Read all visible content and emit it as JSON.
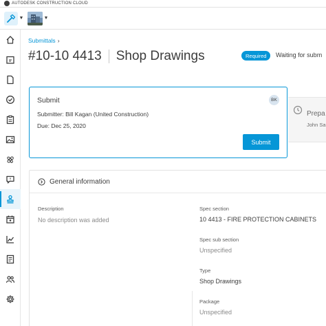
{
  "app": {
    "brand": "AUTODESK CONSTRUCTION CLOUD"
  },
  "toolbar": {
    "tool_icon": "hammer-icon",
    "project_icon": "building-thumbnail"
  },
  "sidebar": {
    "items": [
      {
        "name": "home",
        "icon": "home-icon"
      },
      {
        "name": "sheets",
        "icon": "sheets-icon"
      },
      {
        "name": "files",
        "icon": "file-icon"
      },
      {
        "name": "issues",
        "icon": "check-circle-icon"
      },
      {
        "name": "forms",
        "icon": "clipboard-icon"
      },
      {
        "name": "photos",
        "icon": "photo-icon"
      },
      {
        "name": "models",
        "icon": "model-icon"
      },
      {
        "name": "rfis",
        "icon": "chat-icon"
      },
      {
        "name": "submittals",
        "icon": "stamp-icon",
        "active": true
      },
      {
        "name": "schedule",
        "icon": "calendar-icon"
      },
      {
        "name": "insight",
        "icon": "chart-icon"
      },
      {
        "name": "reports",
        "icon": "report-icon"
      },
      {
        "name": "members",
        "icon": "members-icon"
      },
      {
        "name": "settings",
        "icon": "gear-icon"
      }
    ]
  },
  "breadcrumb": {
    "parent": "Submittals",
    "sep": "›"
  },
  "header": {
    "number": "#10-10 4413",
    "name": "Shop Drawings",
    "badge": "Required",
    "status": "Waiting for subm"
  },
  "submit_card": {
    "title": "Submit",
    "avatar": "BK",
    "submitter": "Submitter: Bill Kagan (United Construction)",
    "due": "Due: Dec 25, 2020",
    "button": "Submit"
  },
  "prep_card": {
    "title": "Prepa",
    "sub": "John Sa"
  },
  "general": {
    "title": "General information",
    "description_label": "Description",
    "description_value": "No description was added",
    "spec_label": "Spec section",
    "spec_value": "10 4413 - FIRE PROTECTION CABINETS",
    "spec_sub_label": "Spec sub section",
    "spec_sub_value": "Unspecified",
    "type_label": "Type",
    "type_value": "Shop Drawings",
    "package_label": "Package",
    "package_value": "Unspecified"
  },
  "colors": {
    "accent": "#0696d7",
    "active_bg": "#e8f4fb"
  }
}
